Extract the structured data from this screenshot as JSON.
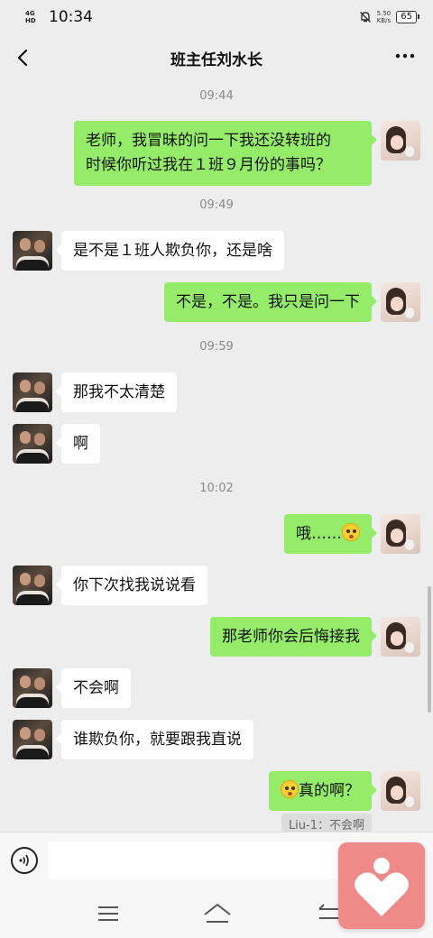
{
  "status": {
    "network": [
      "4G",
      "HD"
    ],
    "time": "10:34",
    "speed": [
      "5.50",
      "KB/s"
    ],
    "battery": "65"
  },
  "header": {
    "title": "班主任刘水长"
  },
  "messages": [
    {
      "type": "time",
      "text": "09:44"
    },
    {
      "type": "out",
      "lines": [
        "老师，我冒昧的问一下我还没转班的",
        "时候你听过我在１班９月份的事吗？"
      ]
    },
    {
      "type": "time",
      "text": "09:49"
    },
    {
      "type": "in",
      "text": "是不是１班人欺负你，还是啥"
    },
    {
      "type": "out",
      "text": "不是，不是。我只是问一下"
    },
    {
      "type": "time",
      "text": "09:59"
    },
    {
      "type": "in",
      "text": "那我不太清楚"
    },
    {
      "type": "in",
      "text": "啊"
    },
    {
      "type": "time",
      "text": "10:02"
    },
    {
      "type": "out",
      "text": "哦……",
      "emoji": "flushed-face-emoji"
    },
    {
      "type": "in",
      "text": "你下次找我说说看"
    },
    {
      "type": "out",
      "text": "那老师你会后悔接我"
    },
    {
      "type": "in",
      "text": "不会啊"
    },
    {
      "type": "in",
      "text": "谁欺负你，就要跟我直说"
    },
    {
      "type": "out",
      "text": "真的啊？",
      "emoji": "flushed-face-emoji"
    }
  ],
  "quote": "Liu-1：不会啊",
  "input": {
    "value": ""
  },
  "icons": {
    "back": "chevron-left-icon",
    "more": "more-dots-icon",
    "voice": "voice-icon",
    "menu": "menu-icon",
    "home": "home-icon",
    "sys_back": "back-arrow-icon",
    "float_app": "heart-app-icon"
  },
  "colors": {
    "outgoing": "#95ec69",
    "incoming": "#ffffff",
    "background": "#ededed",
    "float_app": "#ef8a88"
  }
}
